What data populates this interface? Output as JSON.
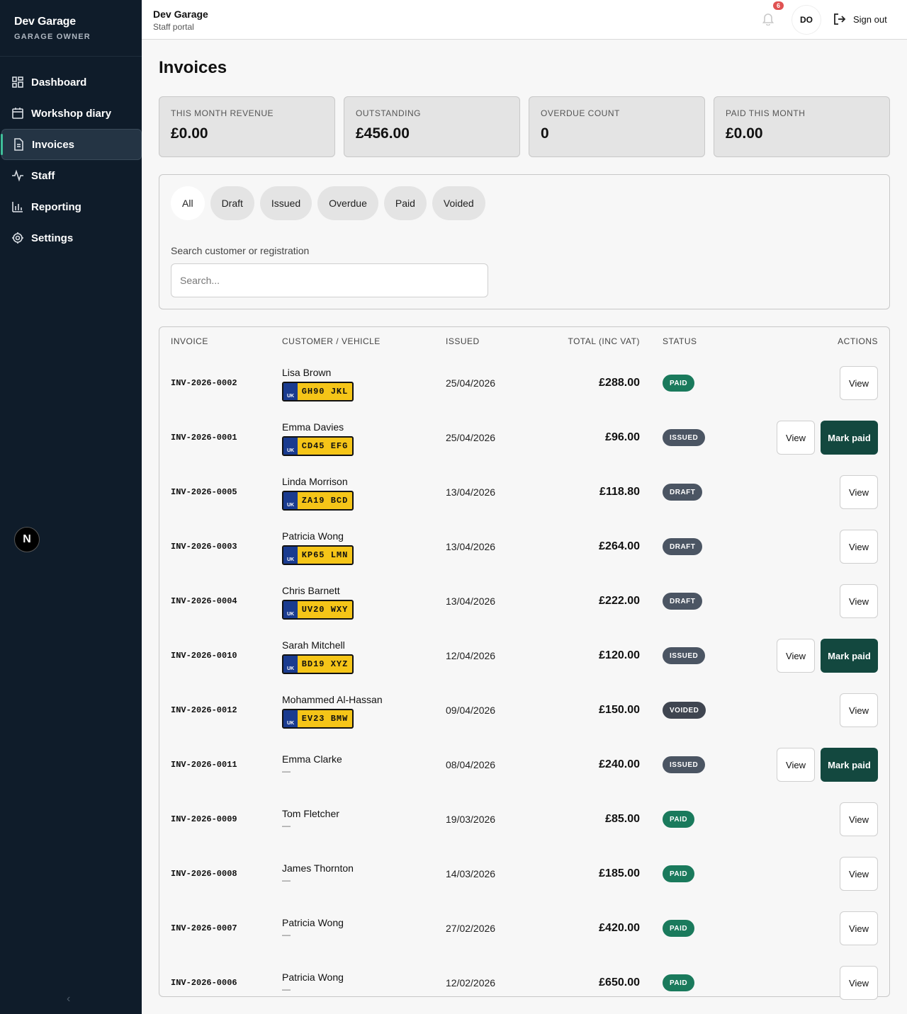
{
  "sidebar": {
    "brand": "Dev Garage",
    "role": "GARAGE OWNER",
    "items": [
      {
        "label": "Dashboard",
        "icon": "dashboard-icon"
      },
      {
        "label": "Workshop diary",
        "icon": "calendar-icon"
      },
      {
        "label": "Invoices",
        "icon": "document-icon"
      },
      {
        "label": "Staff",
        "icon": "activity-icon"
      },
      {
        "label": "Reporting",
        "icon": "bar-chart-icon"
      },
      {
        "label": "Settings",
        "icon": "gear-icon"
      }
    ],
    "active_index": 2,
    "next_badge": "N",
    "collapse_glyph": "‹"
  },
  "topbar": {
    "title": "Dev Garage",
    "subtitle": "Staff portal",
    "notification_count": "6",
    "avatar_initials": "DO",
    "signout_label": "Sign out"
  },
  "page": {
    "title": "Invoices"
  },
  "stats": [
    {
      "label": "THIS MONTH REVENUE",
      "value": "£0.00"
    },
    {
      "label": "OUTSTANDING",
      "value": "£456.00"
    },
    {
      "label": "OVERDUE COUNT",
      "value": "0"
    },
    {
      "label": "PAID THIS MONTH",
      "value": "£0.00"
    }
  ],
  "filters": {
    "chips": [
      "All",
      "Draft",
      "Issued",
      "Overdue",
      "Paid",
      "Voided"
    ],
    "active": "All",
    "search_label": "Search customer or registration",
    "search_placeholder": "Search...",
    "search_value": ""
  },
  "table": {
    "headers": {
      "invoice": "INVOICE",
      "customer": "CUSTOMER / VEHICLE",
      "issued": "ISSUED",
      "total": "TOTAL (INC VAT)",
      "status": "STATUS",
      "actions": "ACTIONS"
    },
    "view_label": "View",
    "mark_paid_label": "Mark paid",
    "plate_country": "UK",
    "no_vehicle": "—",
    "rows": [
      {
        "invoice": "INV-2026-0002",
        "customer": "Lisa Brown",
        "reg": "GH90 JKL",
        "issued": "25/04/2026",
        "total": "£288.00",
        "status": "PAID",
        "mark_paid": false
      },
      {
        "invoice": "INV-2026-0001",
        "customer": "Emma Davies",
        "reg": "CD45 EFG",
        "issued": "25/04/2026",
        "total": "£96.00",
        "status": "ISSUED",
        "mark_paid": true
      },
      {
        "invoice": "INV-2026-0005",
        "customer": "Linda Morrison",
        "reg": "ZA19 BCD",
        "issued": "13/04/2026",
        "total": "£118.80",
        "status": "DRAFT",
        "mark_paid": false
      },
      {
        "invoice": "INV-2026-0003",
        "customer": "Patricia Wong",
        "reg": "KP65 LMN",
        "issued": "13/04/2026",
        "total": "£264.00",
        "status": "DRAFT",
        "mark_paid": false
      },
      {
        "invoice": "INV-2026-0004",
        "customer": "Chris Barnett",
        "reg": "UV20 WXY",
        "issued": "13/04/2026",
        "total": "£222.00",
        "status": "DRAFT",
        "mark_paid": false
      },
      {
        "invoice": "INV-2026-0010",
        "customer": "Sarah Mitchell",
        "reg": "BD19 XYZ",
        "issued": "12/04/2026",
        "total": "£120.00",
        "status": "ISSUED",
        "mark_paid": true
      },
      {
        "invoice": "INV-2026-0012",
        "customer": "Mohammed Al-Hassan",
        "reg": "EV23 BMW",
        "issued": "09/04/2026",
        "total": "£150.00",
        "status": "VOIDED",
        "mark_paid": false
      },
      {
        "invoice": "INV-2026-0011",
        "customer": "Emma Clarke",
        "reg": "",
        "issued": "08/04/2026",
        "total": "£240.00",
        "status": "ISSUED",
        "mark_paid": true
      },
      {
        "invoice": "INV-2026-0009",
        "customer": "Tom Fletcher",
        "reg": "",
        "issued": "19/03/2026",
        "total": "£85.00",
        "status": "PAID",
        "mark_paid": false
      },
      {
        "invoice": "INV-2026-0008",
        "customer": "James Thornton",
        "reg": "",
        "issued": "14/03/2026",
        "total": "£185.00",
        "status": "PAID",
        "mark_paid": false
      },
      {
        "invoice": "INV-2026-0007",
        "customer": "Patricia Wong",
        "reg": "",
        "issued": "27/02/2026",
        "total": "£420.00",
        "status": "PAID",
        "mark_paid": false
      },
      {
        "invoice": "INV-2026-0006",
        "customer": "Patricia Wong",
        "reg": "",
        "issued": "12/02/2026",
        "total": "£650.00",
        "status": "PAID",
        "mark_paid": false
      }
    ]
  }
}
